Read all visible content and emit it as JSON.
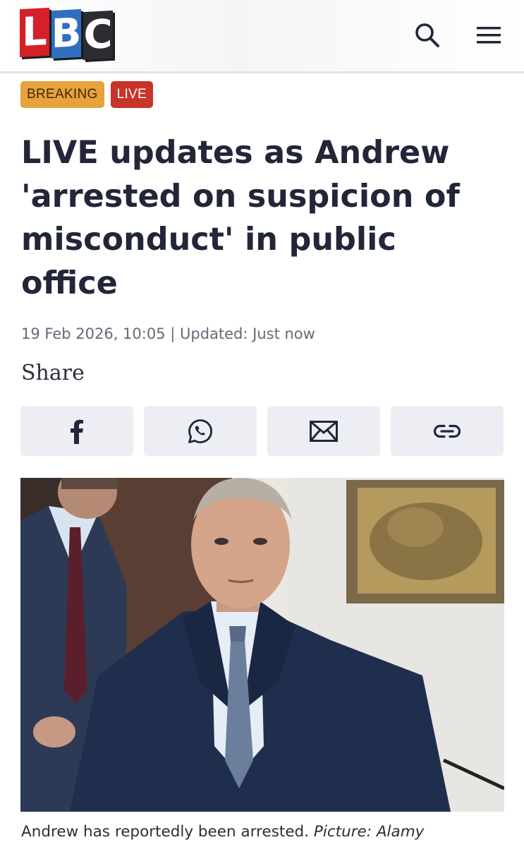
{
  "brand": {
    "logo_letters": [
      "L",
      "B",
      "C"
    ],
    "colors": {
      "l": "#d5202a",
      "b": "#2f6fbe",
      "c": "#2b2d33"
    }
  },
  "header": {
    "search_icon": "search-icon",
    "menu_icon": "hamburger-menu-icon"
  },
  "badges": {
    "breaking": "BREAKING",
    "live": "LIVE"
  },
  "article": {
    "headline": "LIVE updates as Andrew 'arrested on suspicion of misconduct' in public office",
    "meta": "19 Feb 2026, 10:05 | Updated: Just now"
  },
  "share": {
    "label": "Share",
    "buttons": [
      {
        "icon": "facebook-icon"
      },
      {
        "icon": "whatsapp-icon"
      },
      {
        "icon": "email-icon"
      },
      {
        "icon": "link-icon"
      }
    ]
  },
  "image": {
    "caption_text": "Andrew has reportedly been arrested.",
    "caption_credit": "Picture: Alamy"
  }
}
